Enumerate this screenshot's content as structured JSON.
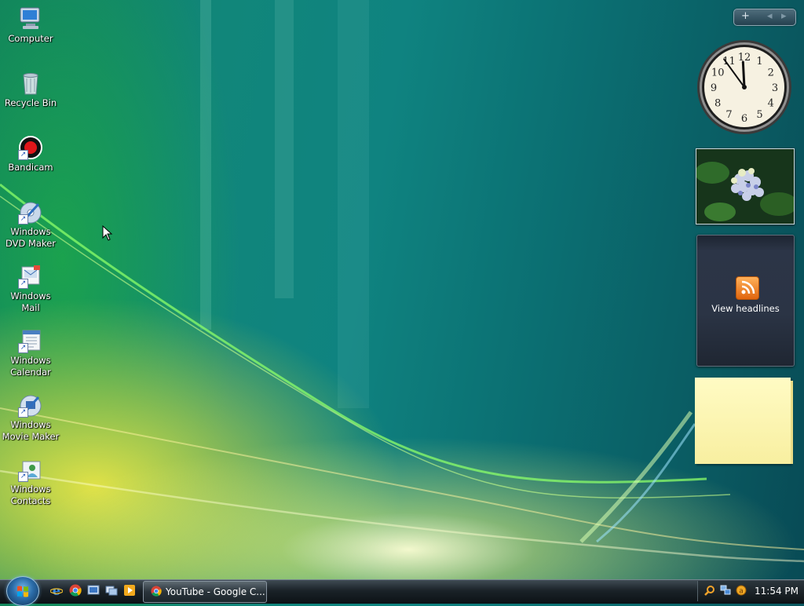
{
  "desktop": {
    "icons": [
      {
        "label": "Computer",
        "icon": "computer-icon"
      },
      {
        "label": "Recycle Bin",
        "icon": "recycle-bin-icon"
      },
      {
        "label": "Bandicam",
        "icon": "bandicam-icon"
      },
      {
        "label": "Windows DVD Maker",
        "icon": "dvd-maker-icon"
      },
      {
        "label": "Windows Mail",
        "icon": "mail-icon"
      },
      {
        "label": "Windows Calendar",
        "icon": "calendar-icon"
      },
      {
        "label": "Windows Movie Maker",
        "icon": "movie-maker-icon"
      },
      {
        "label": "Windows Contacts",
        "icon": "contacts-icon"
      }
    ]
  },
  "sidebar": {
    "controls": {
      "add": "+",
      "prev": "◂",
      "next": "▸"
    },
    "clock": {
      "numbers": [
        "12",
        "1",
        "2",
        "3",
        "4",
        "5",
        "6",
        "7",
        "8",
        "9",
        "10",
        "11"
      ],
      "hour": 11.9,
      "minute": 54
    },
    "feed": {
      "label": "View headlines"
    }
  },
  "taskbar": {
    "quick_launch": [
      "ie-icon",
      "chrome-icon",
      "show-desktop-icon",
      "switch-windows-icon",
      "media-player-icon"
    ],
    "window_button": {
      "label": "YouTube - Google C..."
    },
    "tray": {
      "time": "11:54 PM"
    }
  },
  "colors": {
    "accent": "#2b6ca8",
    "rss": "#f08a24",
    "note": "#fdf7b4"
  }
}
